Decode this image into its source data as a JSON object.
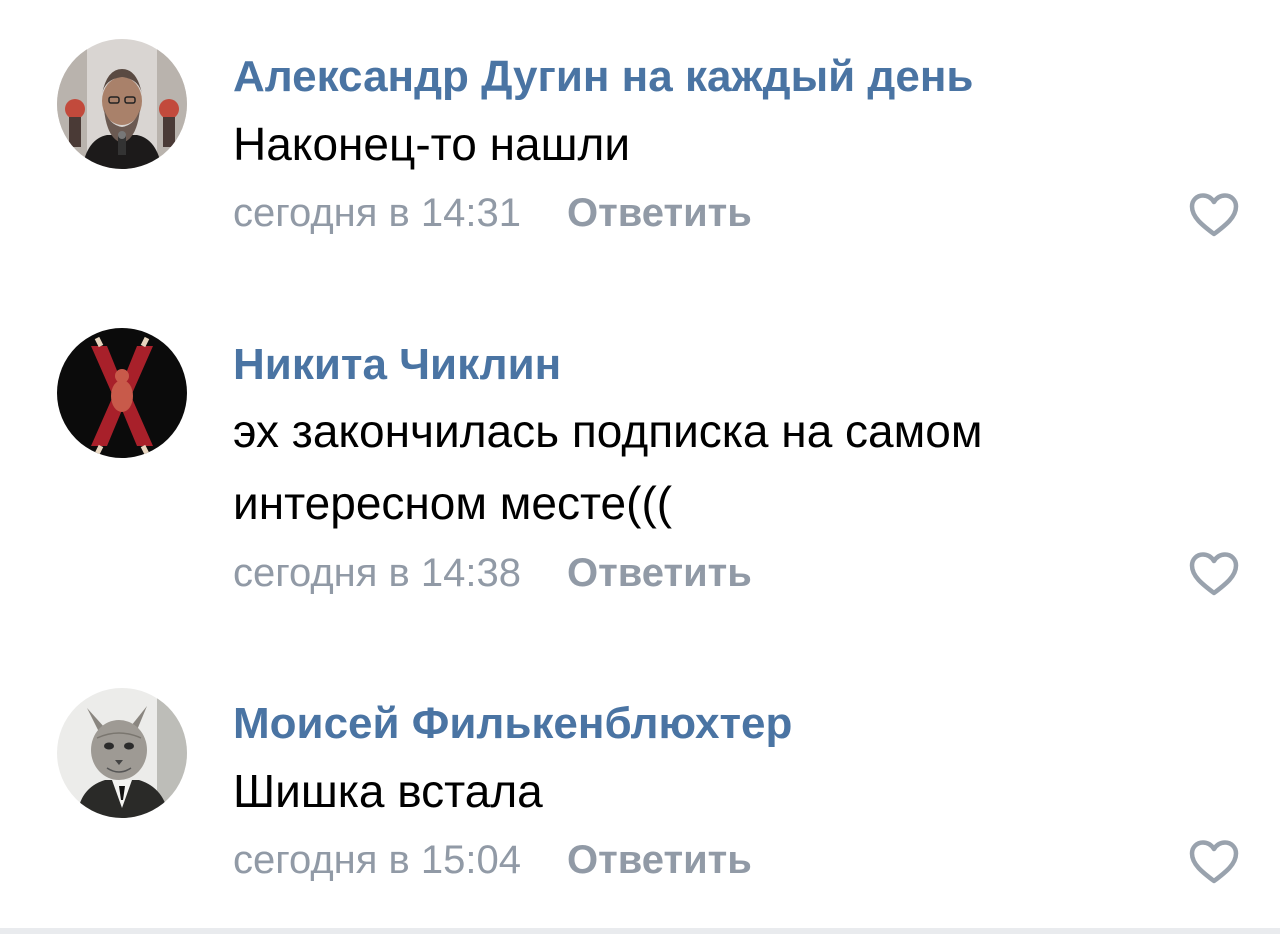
{
  "comments": [
    {
      "author": "Александр Дугин на каждый день",
      "text_lines": [
        "Наконец-то нашли"
      ],
      "time": "сегодня в 14:31",
      "reply_label": "Ответить",
      "avatar_icon": "bearded-man-at-microphone-photo",
      "like_icon": "heart-outline-icon"
    },
    {
      "author": "Никита Чиклин",
      "text_lines": [
        "эх закончилась подписка на самом",
        "интересном месте((("
      ],
      "time": "сегодня в 14:38",
      "reply_label": "Ответить",
      "avatar_icon": "red-x-cross-figure-image",
      "like_icon": "heart-outline-icon"
    },
    {
      "author": "Моисей Филькенблюхтер",
      "text_lines": [
        "Шишка встала"
      ],
      "time": "сегодня в 15:04",
      "reply_label": "Ответить",
      "avatar_icon": "cat-head-in-suit-engraving",
      "like_icon": "heart-outline-icon"
    }
  ],
  "colors": {
    "author": "#4a74a3",
    "meta": "#919aa6",
    "text": "#000000",
    "like_outline": "#99a2ad"
  }
}
